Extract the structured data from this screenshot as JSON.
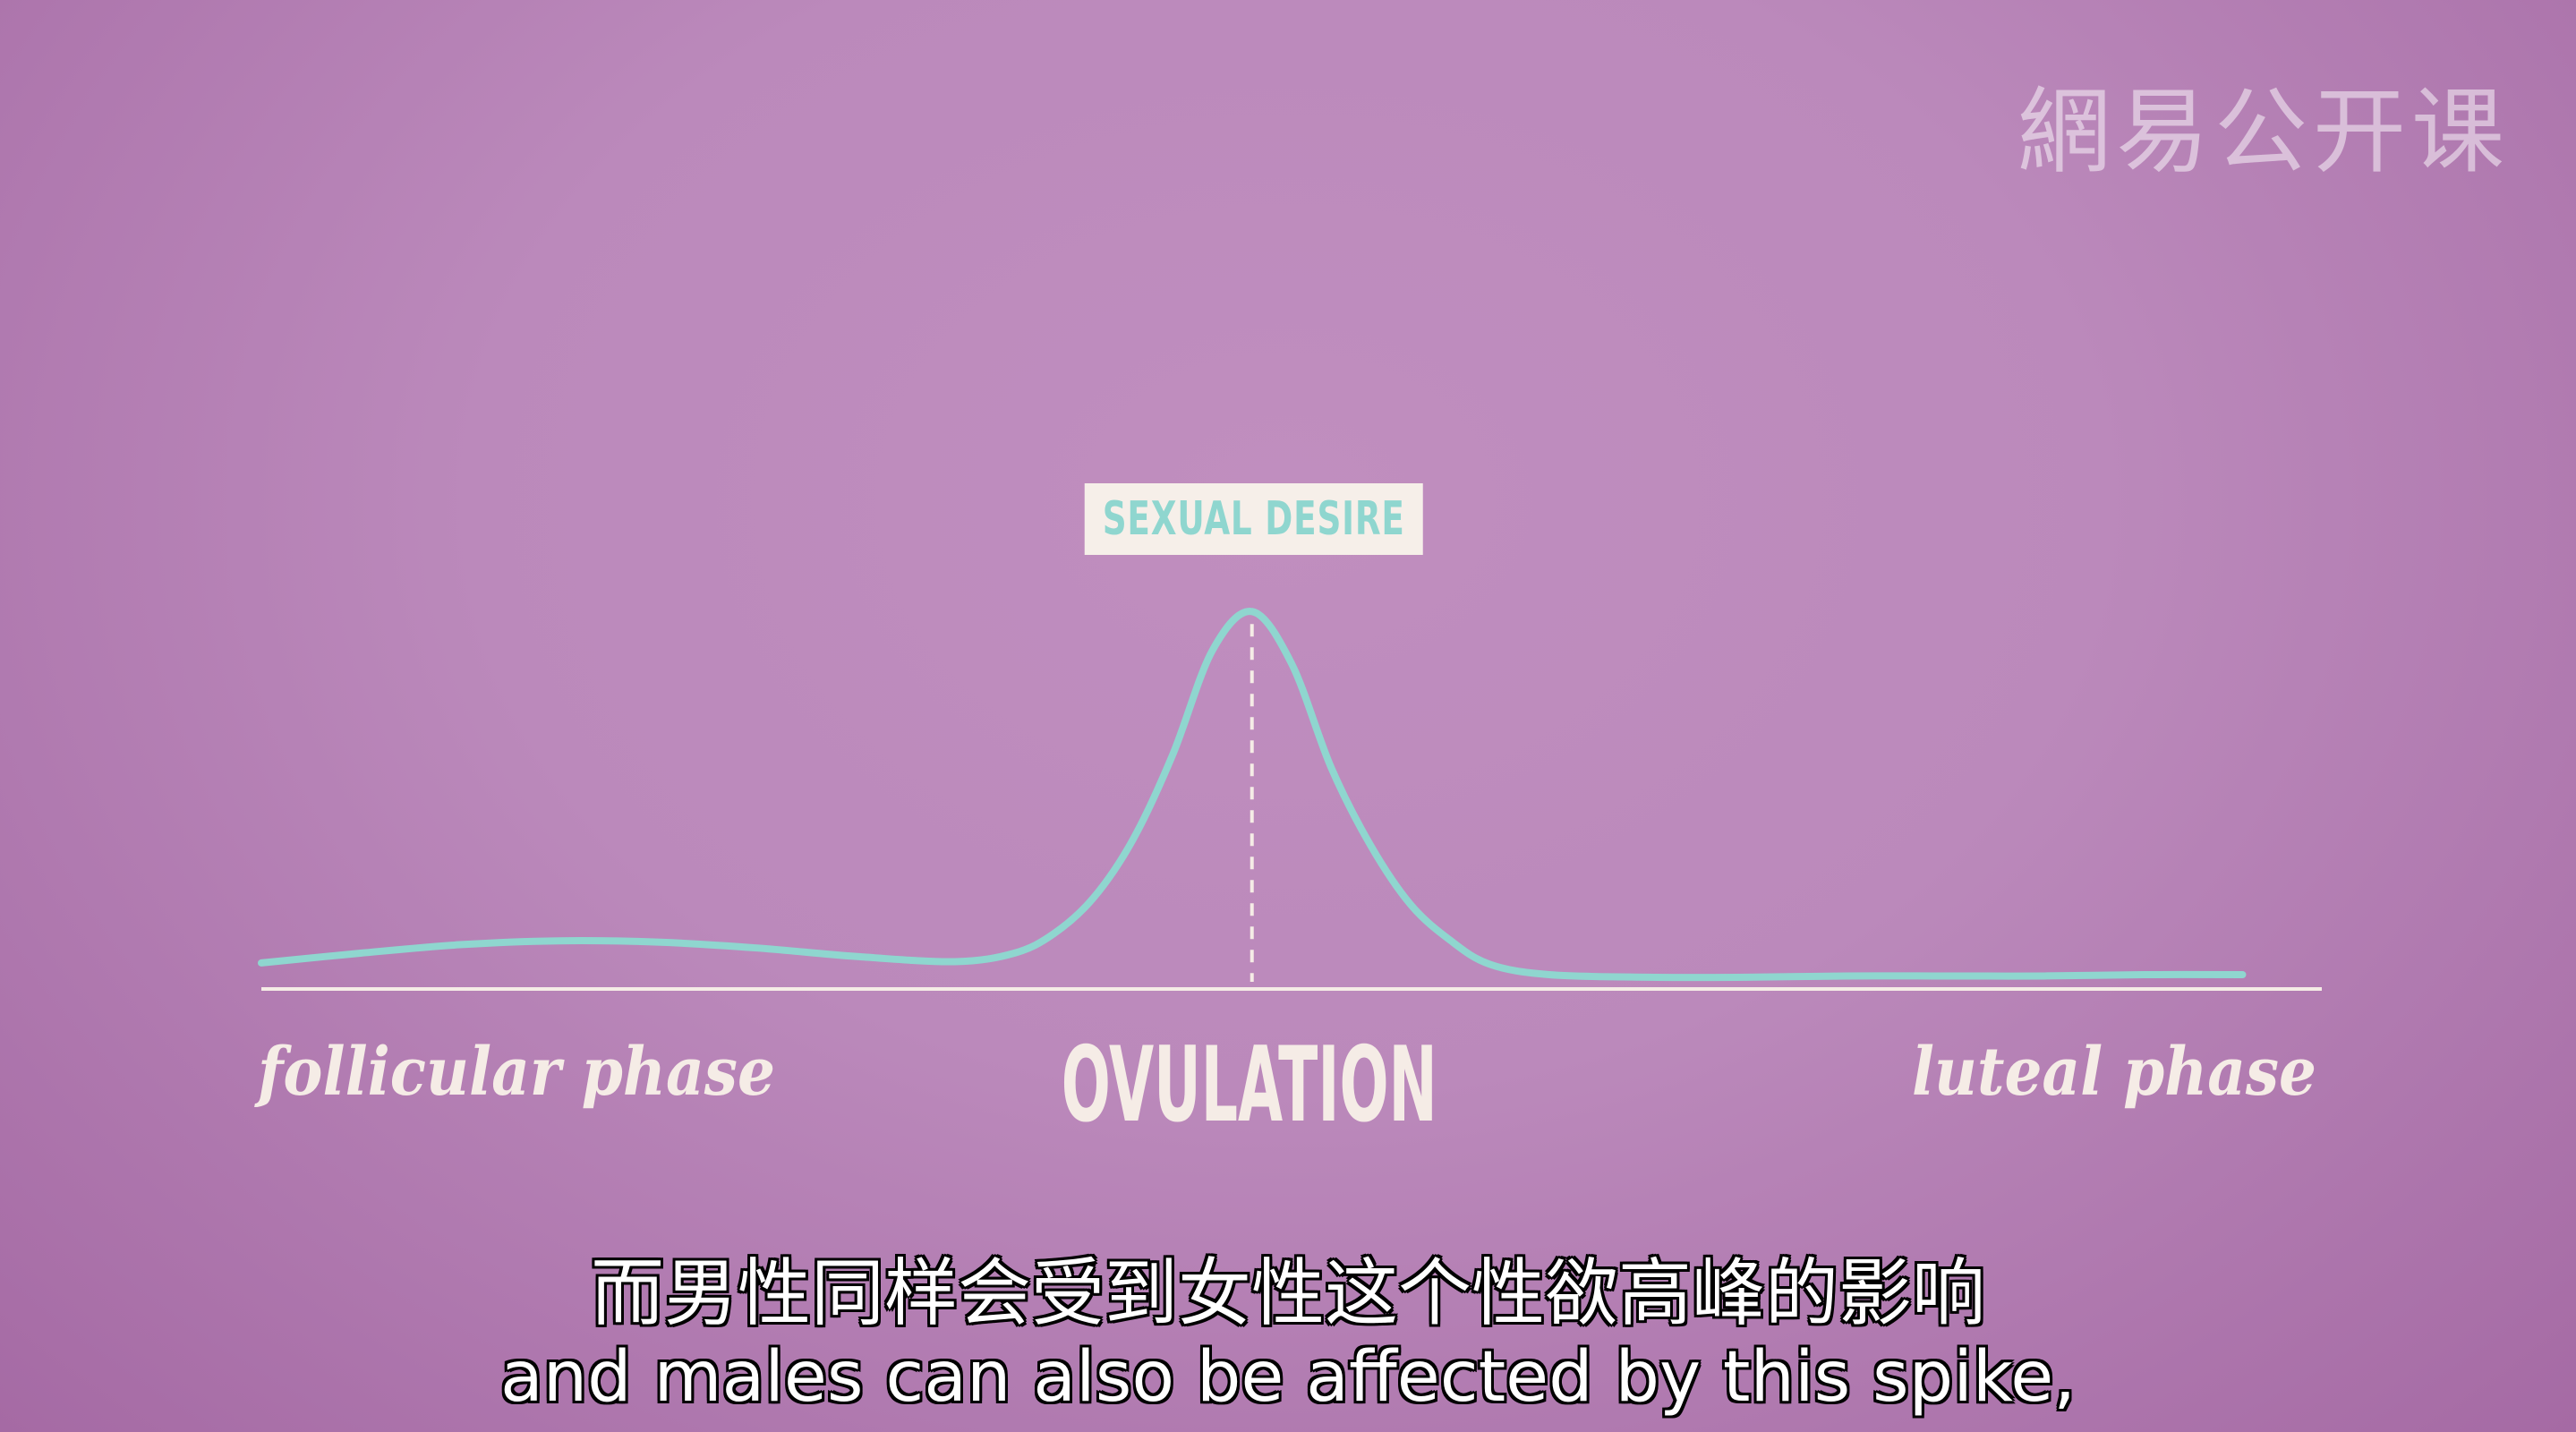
{
  "watermark": "網易公开课",
  "subtitles": {
    "chinese": "而男性同样会受到女性这个性欲高峰的影响",
    "english": "and males can also be affected by this spike,"
  },
  "colors": {
    "curve": "#8fd6cf",
    "axis": "#f5ece6",
    "label": "#f5ece6",
    "badge_bg": "#f6efe9",
    "badge_text": "#8fd6cf"
  },
  "chart_data": {
    "type": "line",
    "title": "",
    "series": [
      {
        "name": "SEXUAL DESIRE",
        "x": [
          0,
          5,
          10,
          15,
          20,
          25,
          30,
          35,
          38,
          40,
          42,
          44,
          46,
          48,
          50,
          52,
          54,
          56,
          58,
          60,
          62,
          65,
          70,
          75,
          80,
          85,
          90,
          95,
          100
        ],
        "y": [
          4,
          5.5,
          6.8,
          7.4,
          7.2,
          6.3,
          5,
          4.2,
          5.5,
          8.5,
          14,
          23,
          36,
          52,
          58,
          50,
          34,
          22,
          13,
          7.5,
          3.8,
          2.2,
          1.8,
          1.8,
          2,
          2,
          2,
          2.2,
          2.2
        ]
      }
    ],
    "peak": {
      "x": 50,
      "label": "SEXUAL DESIRE"
    },
    "x_labels": [
      {
        "text": "follicular phase",
        "position": "left"
      },
      {
        "text": "OVULATION",
        "position": "center"
      },
      {
        "text": "luteal phase",
        "position": "right"
      }
    ],
    "xlim": [
      0,
      104
    ],
    "ylim": [
      0,
      70
    ],
    "grid": false,
    "legend": "none"
  }
}
